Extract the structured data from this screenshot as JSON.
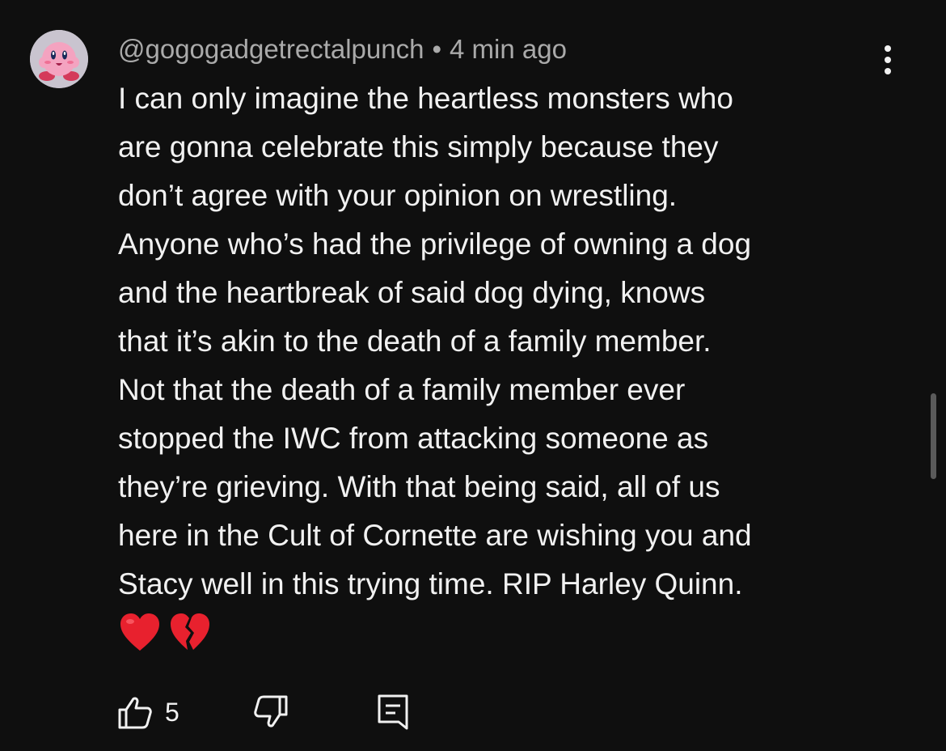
{
  "comment": {
    "author": "@gogogadgetrectalpunch",
    "separator": "•",
    "timestamp": "4 min ago",
    "text": "I can only imagine the heartless monsters who\nare gonna celebrate this simply because they\ndon’t agree with your opinion on wrestling.\nAnyone who’s had the privilege of owning a dog\nand the heartbreak of said dog dying, knows\nthat it’s akin to the death of a family member.\nNot that the death of a family member ever\nstopped the IWC from attacking someone as\nthey’re grieving. With that being said, all of us\nhere in the Cult of Cornette are wishing you and\nStacy well in this trying time. RIP Harley Quinn.",
    "emojis": [
      "red-heart",
      "broken-heart"
    ],
    "likes": "5"
  },
  "icons": {
    "menu": "more-vertical-icon",
    "like": "thumb-up-icon",
    "dislike": "thumb-down-icon",
    "reply": "comment-reply-icon"
  },
  "colors": {
    "background": "#0f0f0f",
    "text_primary": "#f1f1f1",
    "text_secondary": "#aaaaaa",
    "heart": "#e8212e"
  }
}
